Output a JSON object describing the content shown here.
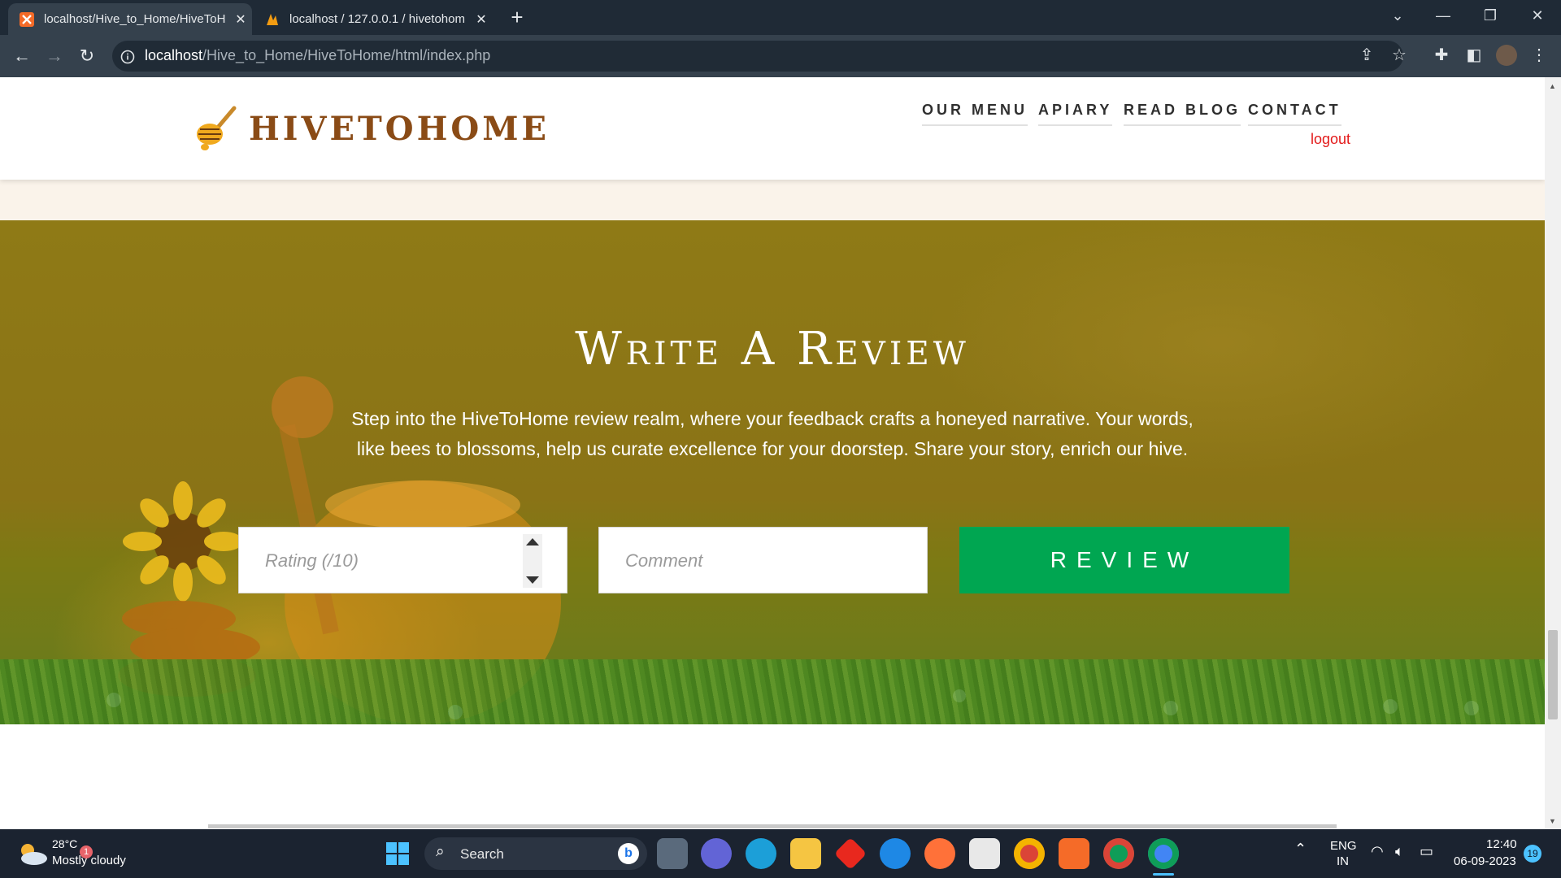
{
  "browser": {
    "tabs": [
      {
        "title": "localhost/Hive_to_Home/HiveToH",
        "active": true
      },
      {
        "title": "localhost / 127.0.0.1 / hivetohom",
        "active": false
      }
    ],
    "url_host": "localhost",
    "url_path": "/Hive_to_Home/HiveToHome/html/index.php"
  },
  "site": {
    "logo": "HIVETOHOME",
    "nav": [
      "OUR MENU",
      "APIARY",
      "READ BLOG",
      "CONTACT"
    ],
    "logout": "logout"
  },
  "review": {
    "title": "Write A Review",
    "desc_line1": "Step into the HiveToHome review realm, where your feedback crafts a honeyed narrative. Your words,",
    "desc_line2": "like bees to blossoms, help us curate excellence for your doorstep. Share your story, enrich our hive.",
    "rating_placeholder": "Rating (/10)",
    "comment_placeholder": "Comment",
    "button": "REVIEW"
  },
  "colors": {
    "brand": "#8a4b16",
    "button": "#00a651",
    "logout": "#e31a1a"
  },
  "taskbar": {
    "weather_temp": "28°C",
    "weather_desc": "Mostly cloudy",
    "weather_badge": "1",
    "search": "Search",
    "lang1": "ENG",
    "lang2": "IN",
    "time": "12:40",
    "date": "06-09-2023",
    "notification_count": "19"
  }
}
